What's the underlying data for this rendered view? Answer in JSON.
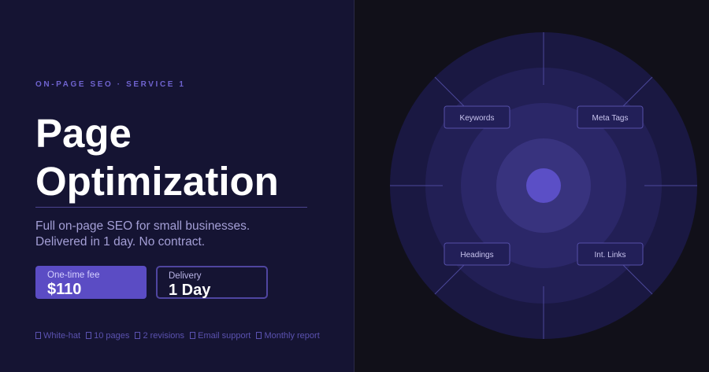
{
  "eyebrow": "ON-PAGE SEO · SERVICE 1",
  "title_line1": "Page",
  "title_line2": "Optimization",
  "description": {
    "line1": "Full on-page SEO for small businesses.",
    "line2": "Delivered in 1 day. No contract."
  },
  "price": {
    "label": "One-time fee",
    "value": "$110"
  },
  "delivery": {
    "label": "Delivery",
    "value": "1 Day"
  },
  "features": [
    "White-hat",
    "10 pages",
    "2 revisions",
    "Email support",
    "Monthly report"
  ],
  "diagram": {
    "nodes": [
      "Keywords",
      "Meta Tags",
      "Headings",
      "Int. Links"
    ]
  },
  "colors": {
    "accent": "#5b4cc4",
    "panel_left": "#151433",
    "panel_right": "#111019",
    "eyebrow": "#6f63cf"
  }
}
